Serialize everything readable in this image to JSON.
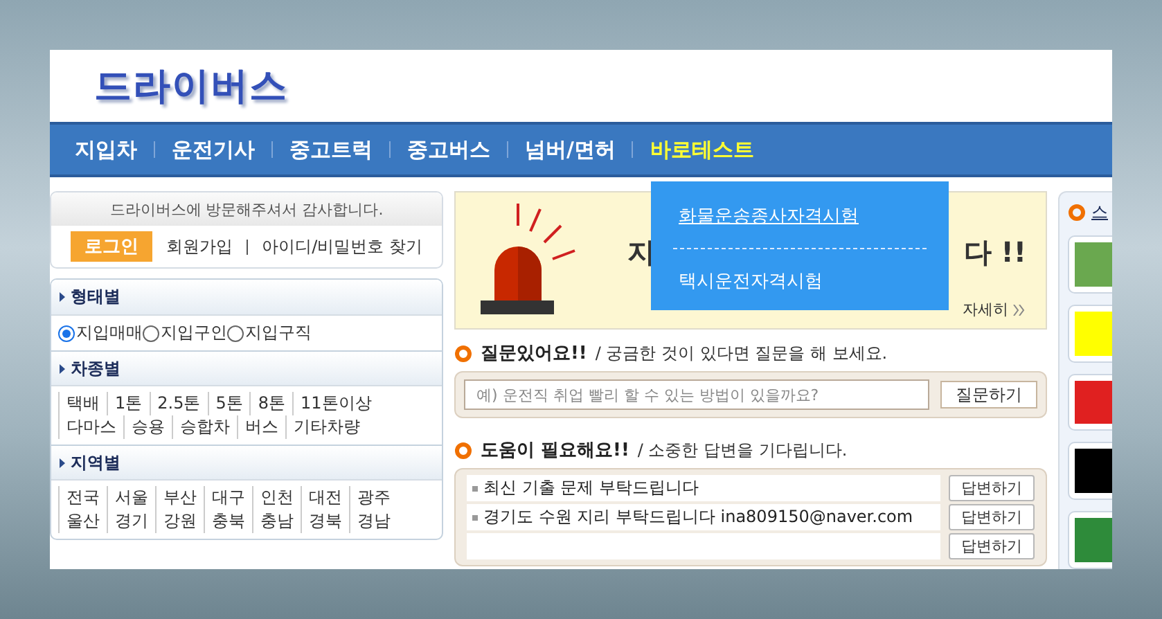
{
  "logo": "드라이버스",
  "nav": [
    {
      "label": "지입차",
      "selected": false
    },
    {
      "label": "운전기사",
      "selected": false
    },
    {
      "label": "중고트럭",
      "selected": false
    },
    {
      "label": "중고버스",
      "selected": false
    },
    {
      "label": "넘버/면허",
      "selected": false
    },
    {
      "label": "바로테스트",
      "selected": true
    }
  ],
  "dropdown": [
    {
      "label": "화물운송종사자격시험",
      "selected": true
    },
    {
      "label": "택시운전자격시험",
      "selected": false
    }
  ],
  "welcome": {
    "message": "드라이버스에 방문해주셔서 감사합니다.",
    "login_button": "로그인",
    "links": [
      "회원가입",
      "아이디/비밀번호 찾기"
    ]
  },
  "filters": [
    {
      "title": "형태별",
      "kind": "radio",
      "options": [
        {
          "label": "지입매매",
          "selected": true
        },
        {
          "label": "지입구인",
          "selected": false
        },
        {
          "label": "지입구직",
          "selected": false
        }
      ]
    },
    {
      "title": "차종별",
      "kind": "links",
      "items": [
        "택배",
        "1톤",
        "2.5톤",
        "5톤",
        "8톤",
        "11톤이상",
        "다마스",
        "승용",
        "승합차",
        "버스",
        "기타차량"
      ]
    },
    {
      "title": "지역별",
      "kind": "links",
      "items": [
        "전국",
        "서울",
        "부산",
        "대구",
        "인천",
        "대전",
        "광주",
        "울산",
        "경기",
        "강원",
        "충북",
        "충남",
        "경북",
        "경남"
      ]
    }
  ],
  "banner": {
    "title_start": "지",
    "title_end": "다 !!",
    "more": "자세히"
  },
  "question": {
    "title": "질문있어요!!",
    "subtitle": "/ 궁금한 것이 있다면 질문을 해 보세요.",
    "placeholder": "예) 운전직 취업 빨리 할 수 있는 방법이 있을까요?",
    "button": "질문하기"
  },
  "help": {
    "title": "도움이 필요해요!!",
    "subtitle": "/ 소중한 답변을 기다립니다.",
    "items": [
      {
        "text": "최신 기출 문제 부탁드립니다",
        "button": "답변하기"
      },
      {
        "text": "경기도 수원 지리 부탁드립니다 ina809150@naver.com",
        "button": "답변하기"
      },
      {
        "button": "답변하기"
      }
    ]
  },
  "sidebar": {
    "title": "스",
    "tiles": [
      {
        "kind": "ad",
        "color": "#6aa84f"
      },
      {
        "kind": "ad",
        "color": "#ffff00"
      },
      {
        "kind": "ad",
        "color": "#e02020"
      },
      {
        "kind": "ad",
        "color": "#000000"
      },
      {
        "kind": "ad",
        "color": "#2e8b3a"
      }
    ]
  }
}
